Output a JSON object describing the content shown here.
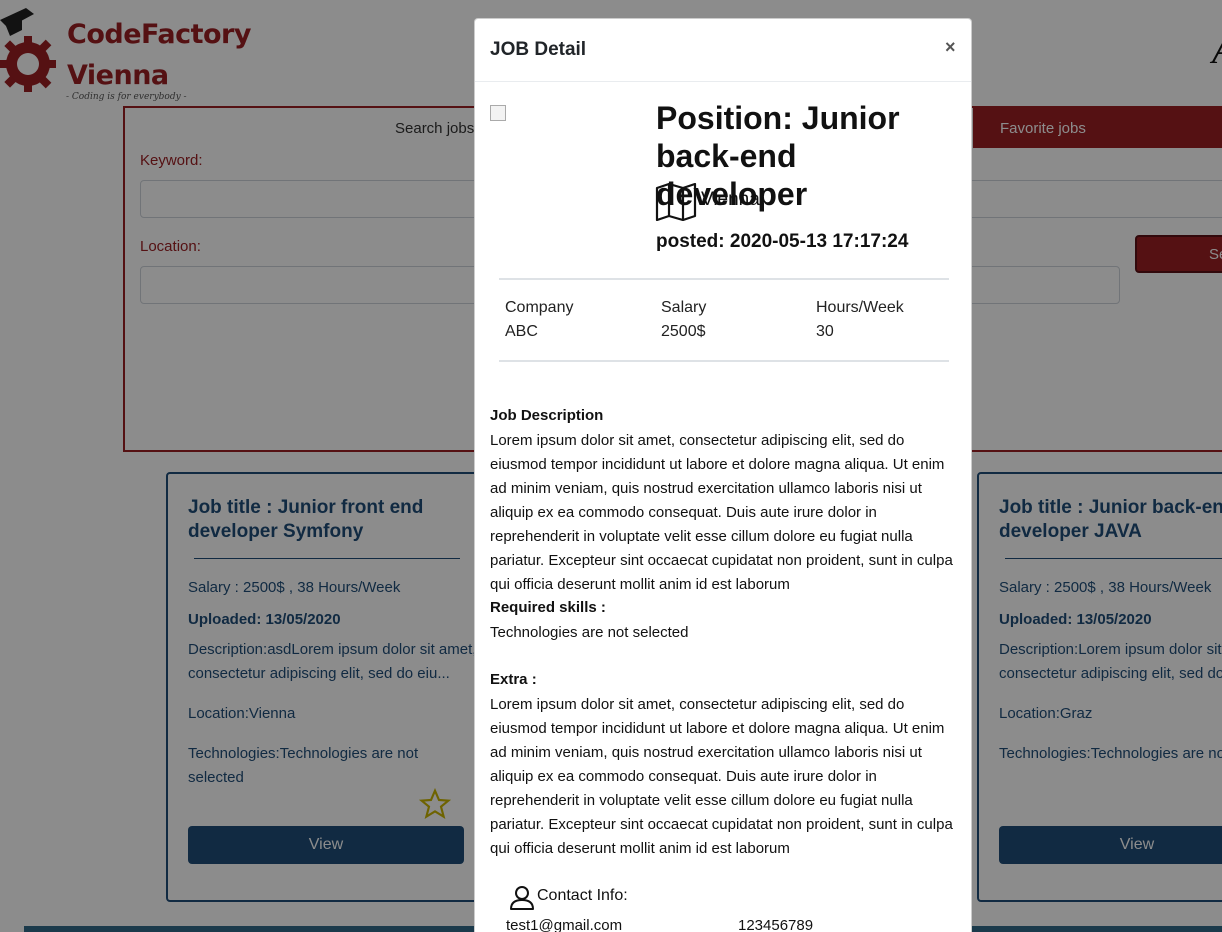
{
  "logo": {
    "line1": "CodeFactory",
    "line2": "Vienna",
    "tagline": "- Coding is for everybody -",
    "brand_color": "#9c1f24"
  },
  "header": {
    "right_fragment": "A"
  },
  "search": {
    "tab_search": "Search jobs",
    "tab_favorites": "Favorite jobs",
    "keyword_label": "Keyword:",
    "keyword_value": "",
    "location_label": "Location:",
    "location_value": "",
    "search_button": "Se"
  },
  "cards": [
    {
      "title": "Job title : Junior front end developer Symfony",
      "salary": "Salary : 2500$ , 38 Hours/Week",
      "uploaded": "Uploaded: 13/05/2020",
      "description": "Description:asdLorem ipsum dolor sit amet, consectetur adipiscing elit, sed do eiu...",
      "location": "Location:Vienna",
      "technologies": "Technologies:Technologies are not selected",
      "view_label": "View"
    },
    {
      "title": "Job title : Junior back-end developer JAVA",
      "salary": "Salary : 2500$ , 38 Hours/Week",
      "uploaded": "Uploaded: 13/05/2020",
      "description": "Description:Lorem ipsum dolor sit amet, consectetur adipiscing elit, sed do eius",
      "location": "Location:Graz",
      "technologies": "Technologies:Technologies are not sele",
      "view_label": "View"
    }
  ],
  "modal": {
    "title": "JOB Detail",
    "close": "×",
    "position": "Position: Junior back-end developer",
    "location": "Vienna",
    "posted": "posted: 2020-05-13 17:17:24",
    "company_label": "Company",
    "company_value": "ABC",
    "salary_label": "Salary",
    "salary_value": "2500$",
    "hours_label": "Hours/Week",
    "hours_value": "30",
    "job_description_title": "Job Description",
    "job_description": "Lorem ipsum dolor sit amet, consectetur adipiscing elit, sed do eiusmod tempor incididunt ut labore et dolore magna aliqua. Ut enim ad minim veniam, quis nostrud exercitation ullamco laboris nisi ut aliquip ex ea commodo consequat. Duis aute irure dolor in reprehenderit in voluptate velit esse cillum dolore eu fugiat nulla pariatur. Excepteur sint occaecat cupidatat non proident, sunt in culpa qui officia deserunt mollit anim id est laborum",
    "required_skills_title": "Required skills :",
    "required_skills": "Technologies are not selected",
    "extra_title": "Extra :",
    "extra": "Lorem ipsum dolor sit amet, consectetur adipiscing elit, sed do eiusmod tempor incididunt ut labore et dolore magna aliqua. Ut enim ad minim veniam, quis nostrud exercitation ullamco laboris nisi ut aliquip ex ea commodo consequat. Duis aute irure dolor in reprehenderit in voluptate velit esse cillum dolore eu fugiat nulla pariatur. Excepteur sint occaecat cupidatat non proident, sunt in culpa qui officia deserunt mollit anim id est laborum",
    "contact_label": "Contact Info:",
    "contact_email": "test1@gmail.com",
    "contact_phone": "123456789"
  },
  "icons": {
    "map": "map-icon",
    "user": "user-icon",
    "star": "star-icon",
    "gear": "gear-icon",
    "cap": "graduation-cap-icon"
  },
  "colors": {
    "card_blue": "#1f4e79",
    "star_yellow": "#c9b400",
    "overlay": "rgba(0,0,0,0.45)"
  }
}
